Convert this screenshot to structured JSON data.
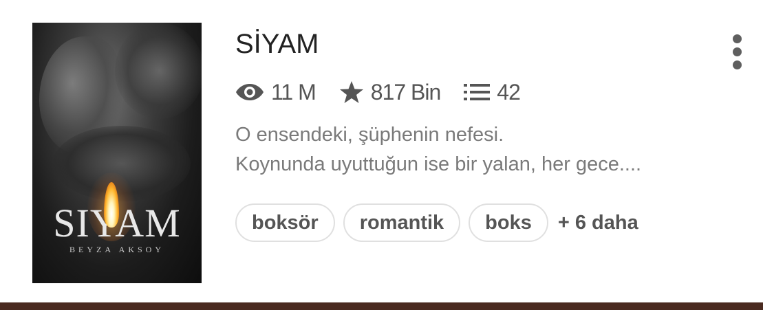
{
  "cover": {
    "title": "SIYAM",
    "author": "BEYZA AKSOY"
  },
  "story": {
    "title": "SİYAM",
    "stats": {
      "views": "11 M",
      "votes": "817 Bin",
      "parts": "42"
    },
    "description_lines": [
      "O ensendeki, şüphenin nefesi.",
      "Koynunda uyuttuğun ise bir yalan, her gece...."
    ],
    "tags": [
      "boksör",
      "romantik",
      "boks"
    ],
    "more_tags": "+ 6 daha"
  },
  "icons": {
    "views": "eye-icon",
    "votes": "star-icon",
    "parts": "list-icon",
    "menu": "more-vertical-icon"
  },
  "colors": {
    "title": "#222222",
    "stats": "#555555",
    "description": "#7a7a7a",
    "bottom_bar": "#4a2a20"
  }
}
